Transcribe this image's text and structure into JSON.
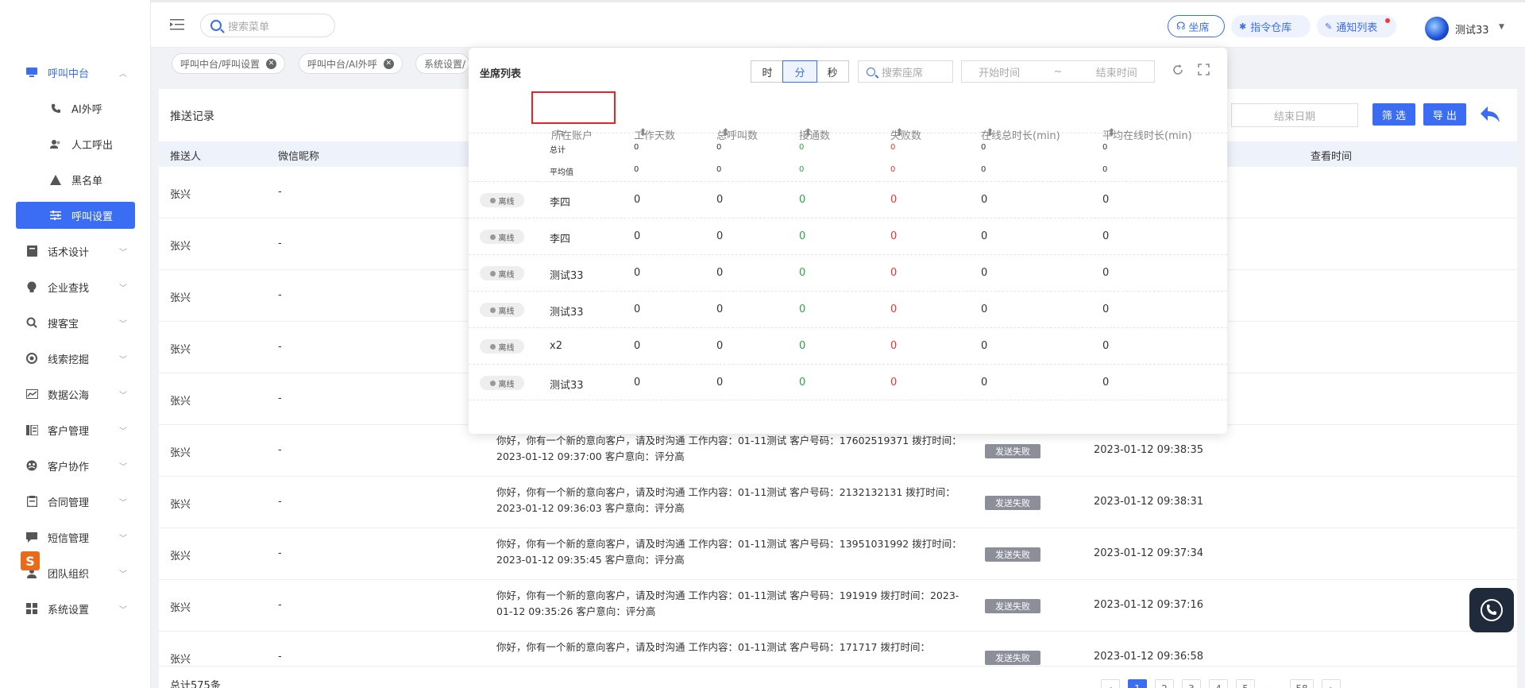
{
  "header": {
    "search_placeholder": "搜索菜单",
    "btn_seat": "坐席",
    "btn_command": "指令仓库",
    "btn_notice": "通知列表",
    "user": "测试33"
  },
  "sidebar": {
    "items": [
      {
        "label": "呼叫中台",
        "icon": "monitor-icon"
      },
      {
        "label": "AI外呼",
        "icon": "phone-icon"
      },
      {
        "label": "人工呼出",
        "icon": "users-icon"
      },
      {
        "label": "黑名单",
        "icon": "warning-icon"
      },
      {
        "label": "呼叫设置",
        "icon": "sliders-icon"
      },
      {
        "label": "话术设计",
        "icon": "book-icon"
      },
      {
        "label": "企业查找",
        "icon": "bulb-icon"
      },
      {
        "label": "搜客宝",
        "icon": "search-icon"
      },
      {
        "label": "线索挖掘",
        "icon": "target-icon"
      },
      {
        "label": "数据公海",
        "icon": "chart-icon"
      },
      {
        "label": "客户管理",
        "icon": "customer-icon"
      },
      {
        "label": "客户协作",
        "icon": "collab-icon"
      },
      {
        "label": "合同管理",
        "icon": "contract-icon"
      },
      {
        "label": "短信管理",
        "icon": "sms-icon"
      },
      {
        "label": "团队组织",
        "icon": "team-icon"
      },
      {
        "label": "系统设置",
        "icon": "grid-icon"
      }
    ]
  },
  "tags": [
    "呼叫中台/呼叫设置",
    "呼叫中台/AI外呼",
    "系统设置/"
  ],
  "main": {
    "title": "推送记录",
    "end_date_placeholder": "结束日期",
    "filter_btn": "筛 选",
    "export_btn": "导 出",
    "columns": {
      "sender": "推送人",
      "wechat": "微信昵称",
      "view_time": "查看时间"
    },
    "rows": [
      {
        "name": "张兴",
        "wx": "-",
        "msg": "",
        "status": "",
        "time": ""
      },
      {
        "name": "张兴",
        "wx": "-",
        "msg": "",
        "status": "",
        "time": ""
      },
      {
        "name": "张兴",
        "wx": "-",
        "msg": "",
        "status": "",
        "time": ""
      },
      {
        "name": "张兴",
        "wx": "-",
        "msg": "",
        "status": "",
        "time": ""
      },
      {
        "name": "张兴",
        "wx": "-",
        "msg": "",
        "status": "",
        "time": ""
      },
      {
        "name": "张兴",
        "wx": "-",
        "msg": "你好，你有一个新的意向客户，请及时沟通 工作内容：01-11测试 客户号码：17602519371 拨打时间：2023-01-12 09:37:00 客户意向：评分高",
        "status": "发送失败",
        "time": "2023-01-12 09:38:35"
      },
      {
        "name": "张兴",
        "wx": "-",
        "msg": "你好，你有一个新的意向客户，请及时沟通 工作内容：01-11测试 客户号码：2132132131 拨打时间：2023-01-12 09:36:03 客户意向：评分高",
        "status": "发送失败",
        "time": "2023-01-12 09:38:31"
      },
      {
        "name": "张兴",
        "wx": "-",
        "msg": "你好，你有一个新的意向客户，请及时沟通 工作内容：01-11测试 客户号码：13951031992 拨打时间：2023-01-12 09:35:45 客户意向：评分高",
        "status": "发送失败",
        "time": "2023-01-12 09:37:34"
      },
      {
        "name": "张兴",
        "wx": "-",
        "msg": "你好，你有一个新的意向客户，请及时沟通 工作内容：01-11测试 客户号码：191919 拨打时间：2023-01-12 09:35:26 客户意向：评分高",
        "status": "发送失败",
        "time": "2023-01-12 09:37:16"
      },
      {
        "name": "张兴",
        "wx": "-",
        "msg": "你好，你有一个新的意向客户，请及时沟通 工作内容：01-11测试 客户号码：171717 拨打时间：",
        "status": "发送失败",
        "time": "2023-01-12 09:36:58"
      }
    ],
    "total": "总计575条",
    "pages": [
      "1",
      "2",
      "3",
      "4",
      "5",
      "···",
      "58"
    ]
  },
  "popup": {
    "title": "坐席列表",
    "seg_hour": "时",
    "seg_min": "分",
    "seg_sec": "秒",
    "seat_search_placeholder": "搜索座席",
    "start_time": "开始时间",
    "tilde": "~",
    "end_time": "结束时间",
    "columns": [
      "所在账户",
      "工作天数",
      "总呼叫数",
      "接通数",
      "失败数",
      "在线总时长(min)",
      "平均在线时长(min)"
    ],
    "summary": [
      {
        "label": "总计",
        "vals": [
          "0",
          "0",
          "0",
          "0",
          "0",
          "0"
        ]
      },
      {
        "label": "平均值",
        "vals": [
          "0",
          "0",
          "0",
          "0",
          "0",
          "0"
        ]
      }
    ],
    "rows": [
      {
        "status": "离线",
        "account": "李四",
        "vals": [
          "0",
          "0",
          "0",
          "0",
          "0",
          "0"
        ]
      },
      {
        "status": "离线",
        "account": "李四",
        "vals": [
          "0",
          "0",
          "0",
          "0",
          "0",
          "0"
        ]
      },
      {
        "status": "离线",
        "account": "测试33",
        "vals": [
          "0",
          "0",
          "0",
          "0",
          "0",
          "0"
        ]
      },
      {
        "status": "离线",
        "account": "测试33",
        "vals": [
          "0",
          "0",
          "0",
          "0",
          "0",
          "0"
        ]
      },
      {
        "status": "离线",
        "account": "x2",
        "vals": [
          "0",
          "0",
          "0",
          "0",
          "0",
          "0"
        ]
      },
      {
        "status": "离线",
        "account": "测试33",
        "vals": [
          "0",
          "0",
          "0",
          "0",
          "0",
          "0"
        ]
      }
    ]
  }
}
